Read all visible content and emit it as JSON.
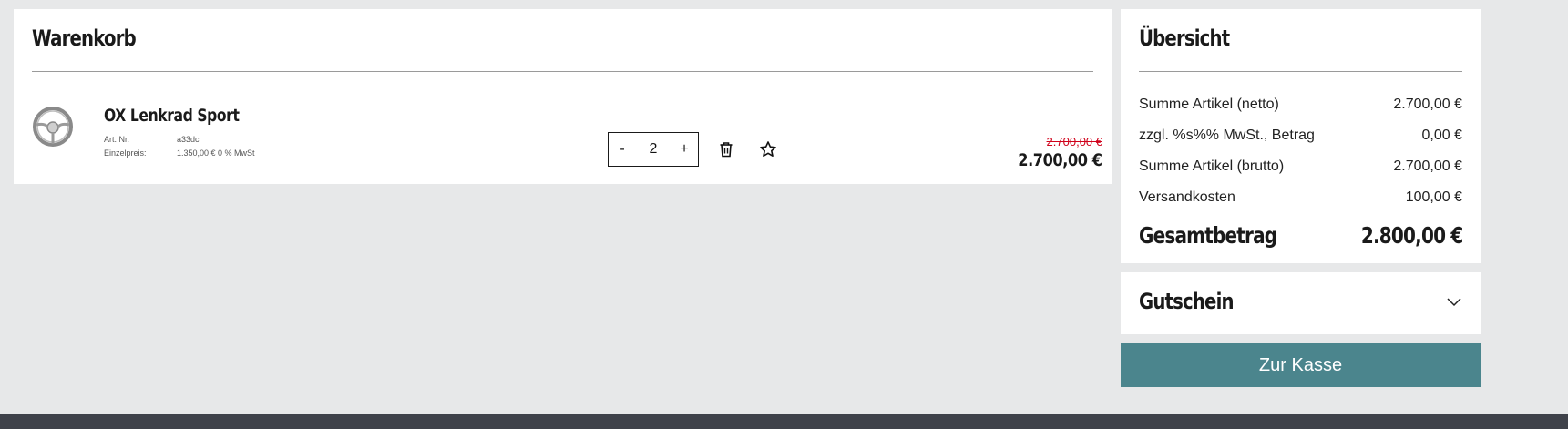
{
  "cart": {
    "title": "Warenkorb",
    "item": {
      "name": "OX Lenkrad Sport",
      "art_nr_label": "Art. Nr.",
      "art_nr_value": "a33dc",
      "unit_price_label": "Einzelpreis:",
      "unit_price_value": "1.350,00 € 0 % MwSt",
      "quantity": "2",
      "minus_label": "-",
      "plus_label": "+",
      "old_price": "2.700,00 €",
      "new_price": "2.700,00 €",
      "thumbnail_icon": "steering-wheel-icon",
      "delete_icon": "trash-icon",
      "wishlist_icon": "star-icon"
    }
  },
  "summary": {
    "title": "Übersicht",
    "rows": [
      {
        "label": "Summe Artikel (netto)",
        "value": "2.700,00 €"
      },
      {
        "label": "zzgl. %s%% MwSt., Betrag",
        "value": "0,00 €"
      },
      {
        "label": "Summe Artikel (brutto)",
        "value": "2.700,00 €"
      },
      {
        "label": "Versandkosten",
        "value": "100,00 €"
      }
    ],
    "total_label": "Gesamtbetrag",
    "total_value": "2.800,00 €"
  },
  "coupon": {
    "title": "Gutschein",
    "expand_icon": "chevron-down-icon"
  },
  "checkout": {
    "label": "Zur Kasse"
  },
  "colors": {
    "background": "#e7e8e9",
    "panel": "#ffffff",
    "checkout_button": "#4b858d",
    "old_price": "#d0021b",
    "footer": "#3f424a"
  }
}
